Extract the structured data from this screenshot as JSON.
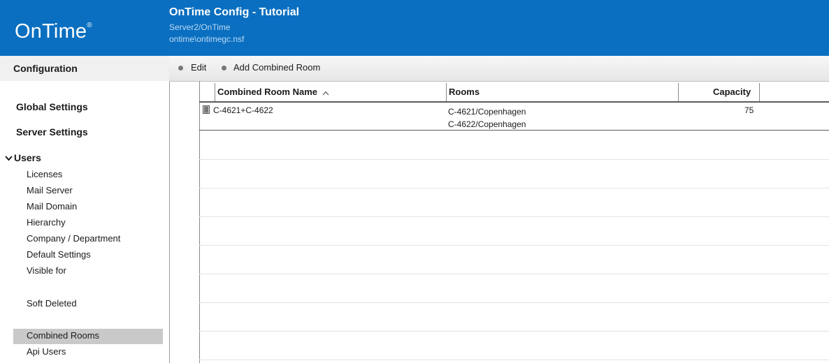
{
  "header": {
    "logo_text": "OnTime",
    "logo_mark": "®",
    "title": "OnTime Config - Tutorial",
    "server": "Server2/OnTime",
    "database": "ontime\\ontimegc.nsf",
    "bar_color": "#0a6fc0"
  },
  "sidebar": {
    "section_label": "Configuration",
    "global_settings": "Global Settings",
    "server_settings": "Server Settings",
    "users_label": "Users",
    "users_expanded_icon": "chevron-down-icon",
    "items": [
      "Licenses",
      "Mail Server",
      "Mail Domain",
      "Hierarchy",
      "Company / Department",
      "Default Settings",
      "Visible for",
      "Soft Deleted",
      "Combined Rooms",
      "Api Users"
    ],
    "selected_item": "Combined Rooms"
  },
  "toolbar": {
    "edit_label": "Edit",
    "add_label": "Add Combined Room"
  },
  "table": {
    "columns": [
      "Combined Room Name",
      "Rooms",
      "Capacity"
    ],
    "sort_indicator": "^",
    "rows": [
      {
        "icon": "door-icon",
        "name": "C-4621+C-4622",
        "rooms": [
          "C-4621/Copenhagen",
          "C-4622/Copenhagen"
        ],
        "capacity": "75"
      }
    ]
  }
}
